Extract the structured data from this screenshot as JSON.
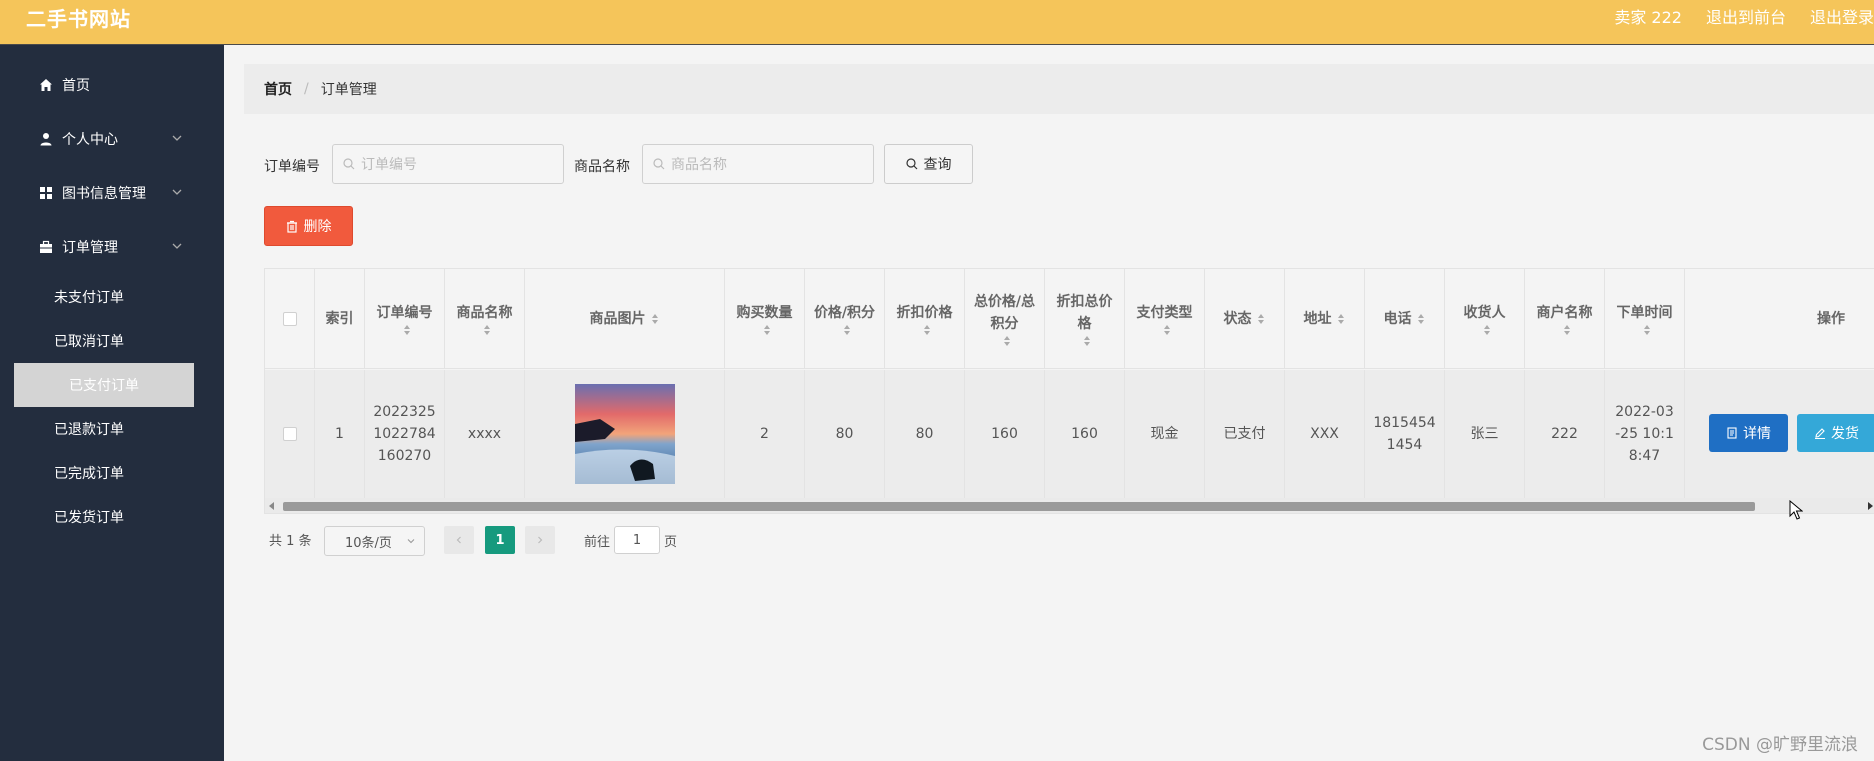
{
  "header": {
    "brand": "二手书网站",
    "user_label": "卖家 222",
    "back_to_front": "退出到前台",
    "logout": "退出登录"
  },
  "sidebar": {
    "items": [
      {
        "label": "首页",
        "icon": "home-icon"
      },
      {
        "label": "个人中心",
        "icon": "user-icon"
      },
      {
        "label": "图书信息管理",
        "icon": "grid-icon"
      },
      {
        "label": "订单管理",
        "icon": "briefcase-icon"
      }
    ],
    "order_sub_items": [
      "未支付订单",
      "已取消订单",
      "已支付订单",
      "已退款订单",
      "已完成订单",
      "已发货订单"
    ],
    "active_sub": "已支付订单"
  },
  "breadcrumb": {
    "home": "首页",
    "separator": "/",
    "current": "订单管理"
  },
  "search": {
    "order_no_label": "订单编号",
    "order_no_placeholder": "订单编号",
    "product_label": "商品名称",
    "product_placeholder": "商品名称",
    "query_button": "查询"
  },
  "toolbar": {
    "delete_button": "删除"
  },
  "table": {
    "headers": {
      "index": "索引",
      "order_no": "订单编号",
      "product": "商品名称",
      "image": "商品图片",
      "quantity": "购买数量",
      "price": "价格/积分",
      "discount_price": "折扣价格",
      "total": "总价格/总积分",
      "discount_total": "折扣总价格",
      "pay_type": "支付类型",
      "status": "状态",
      "address": "地址",
      "phone": "电话",
      "receiver": "收货人",
      "merchant": "商户名称",
      "order_time": "下单时间",
      "actions": "操作"
    },
    "rows": [
      {
        "index": "1",
        "order_no": "2022325 1022784 160270",
        "product": "xxxx",
        "quantity": "2",
        "price": "80",
        "discount_price": "80",
        "total": "160",
        "discount_total": "160",
        "pay_type": "现金",
        "status": "已支付",
        "address": "XXX",
        "phone": "1815454 1454",
        "receiver": "张三",
        "merchant": "222",
        "order_time": "2022-03 -25 10:1 8:47",
        "detail_button": "详情",
        "ship_button": "发货"
      }
    ]
  },
  "pagination": {
    "total": "共 1 条",
    "page_size": "10条/页",
    "current_page": "1",
    "goto_label": "前往",
    "goto_value": "1",
    "page_suffix": "页"
  },
  "watermark": "CSDN @旷野里流浪",
  "colors": {
    "header_bg": "#f5c55a",
    "sidebar_bg": "#232d3e",
    "delete_btn": "#f15a3d",
    "detail_btn": "#1f6fc4",
    "ship_btn": "#34a8d8",
    "page_active": "#169a7e"
  }
}
